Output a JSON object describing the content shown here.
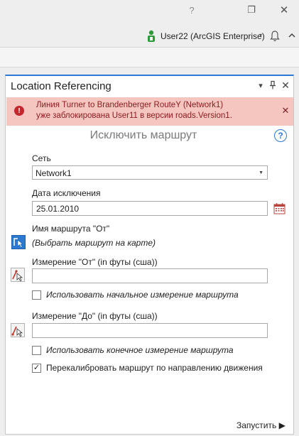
{
  "window": {
    "help_label": "?",
    "restore_label": "❐",
    "close_label": "✕"
  },
  "userbar": {
    "user_name": "User22 (ArcGIS Enterprise)",
    "caret": "▾",
    "accent_color": "#2e9b3a"
  },
  "pane": {
    "title": "Location Referencing",
    "menu_label": "▾",
    "pin_label": "⊥",
    "close_label": "✕"
  },
  "alert": {
    "icon": "!",
    "line1": "Линия Turner to Brandenberger RouteY (Network1)",
    "line2": "уже заблокирована User11 в версии roads.Version1.",
    "close_label": "✕",
    "background": "#f5c6c0"
  },
  "tool": {
    "title": "Исключить маршрут",
    "help_label": "?"
  },
  "form": {
    "network_label": "Сеть",
    "network_value": "Network1",
    "retire_date_label": "Дата исключения",
    "retire_date_value": "25.01.2010",
    "from_route_label": "Имя маршрута \"От\"",
    "from_route_hint": "(Выбрать маршрут на карте)",
    "from_measure_label": "Измерение \"От\" (in футы (сша))",
    "from_measure_value": "",
    "use_start_measure_label": "Использовать начальное измерение маршрута",
    "use_start_measure_checked": false,
    "to_measure_label": "Измерение \"До\" (in футы (сша))",
    "to_measure_value": "",
    "use_end_measure_label": "Использовать конечное измерение маршрута",
    "use_end_measure_checked": false,
    "recalibrate_label": "Перекалибровать маршрут по направлению движения",
    "recalibrate_checked": true,
    "checkmark": "✓"
  },
  "actions": {
    "run_label": "Запустить ▶"
  }
}
